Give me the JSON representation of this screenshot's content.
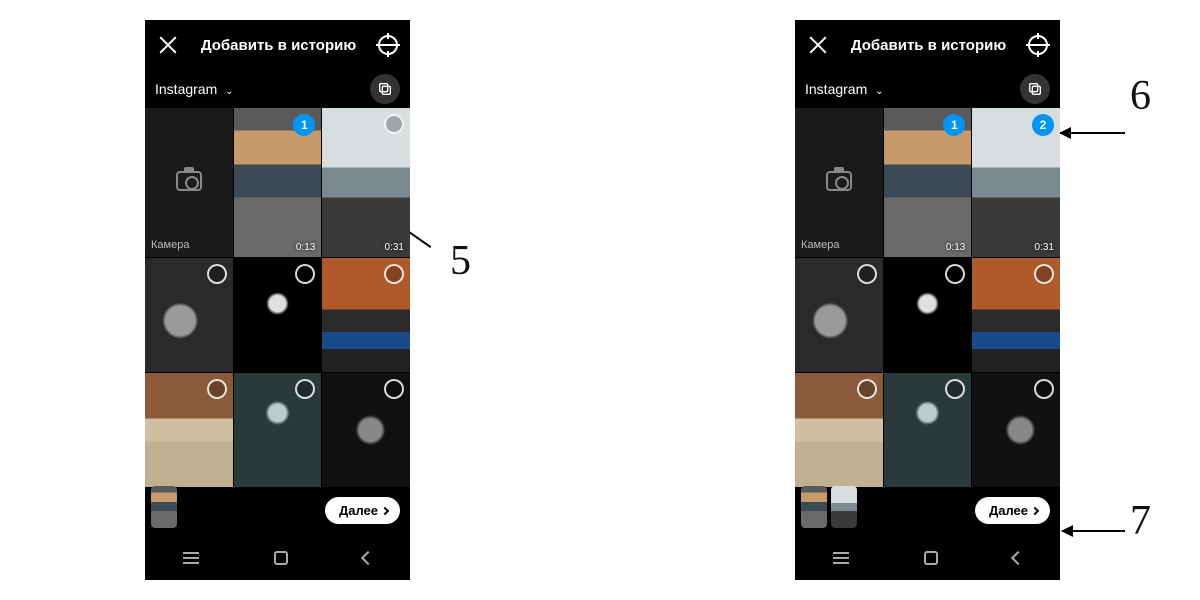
{
  "title": "Добавить в историю",
  "album": {
    "name": "Instagram"
  },
  "camera_label": "Камера",
  "next_label": "Далее",
  "callouts": {
    "five": "5",
    "six": "6",
    "seven": "7"
  },
  "screens": [
    {
      "tiles": [
        {
          "kind": "camera"
        },
        {
          "kind": "video",
          "look": "beach1",
          "duration": "0:13",
          "selected_order": "1"
        },
        {
          "kind": "video",
          "look": "beach2",
          "duration": "0:31"
        },
        {
          "kind": "photo",
          "look": "bw1"
        },
        {
          "kind": "photo",
          "look": "darkface"
        },
        {
          "kind": "photo",
          "look": "orange"
        },
        {
          "kind": "photo",
          "look": "cat"
        },
        {
          "kind": "photo",
          "look": "cave"
        },
        {
          "kind": "photo",
          "look": "bw2"
        }
      ],
      "selected_thumbs": [
        "beach1"
      ]
    },
    {
      "tiles": [
        {
          "kind": "camera"
        },
        {
          "kind": "video",
          "look": "beach1",
          "duration": "0:13",
          "selected_order": "1"
        },
        {
          "kind": "video",
          "look": "beach2",
          "duration": "0:31",
          "selected_order": "2"
        },
        {
          "kind": "photo",
          "look": "bw1"
        },
        {
          "kind": "photo",
          "look": "darkface"
        },
        {
          "kind": "photo",
          "look": "orange"
        },
        {
          "kind": "photo",
          "look": "cat"
        },
        {
          "kind": "photo",
          "look": "cave"
        },
        {
          "kind": "photo",
          "look": "bw2"
        }
      ],
      "selected_thumbs": [
        "beach1",
        "beach2"
      ]
    }
  ]
}
